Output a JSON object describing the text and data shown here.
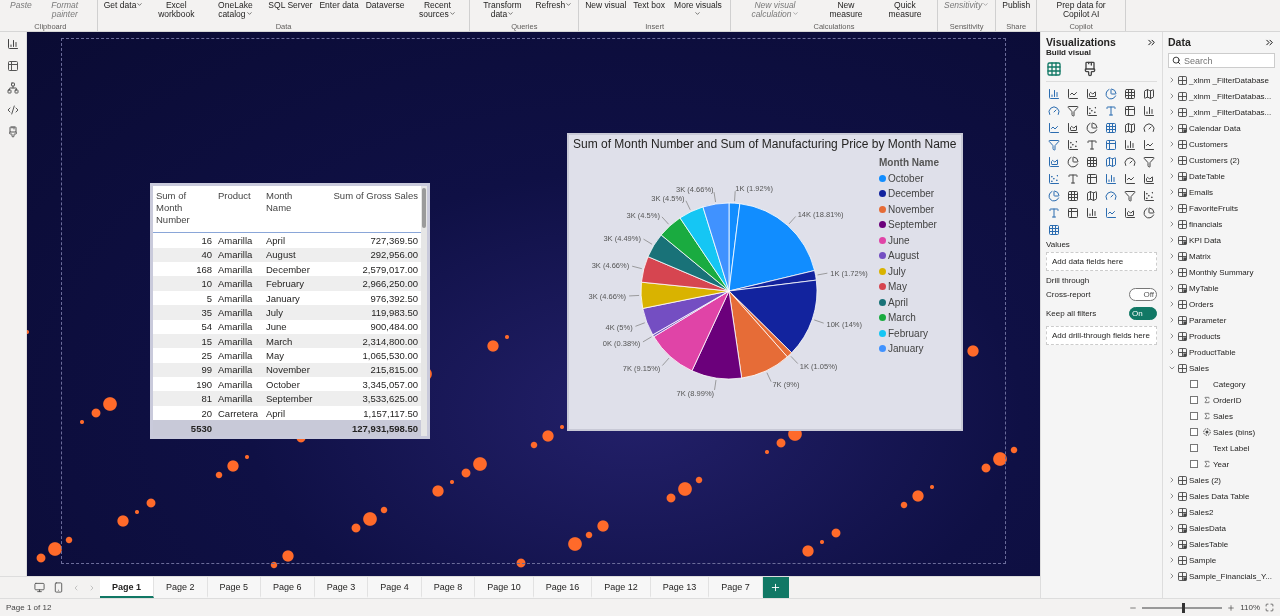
{
  "ribbon": {
    "groups": [
      {
        "label": "Clipboard",
        "buttons": [
          {
            "label": "Paste",
            "disabled": true,
            "dropdown": false
          },
          {
            "label": "Format painter",
            "disabled": true,
            "dropdown": false
          }
        ]
      },
      {
        "label": "Data",
        "buttons": [
          {
            "label": "Get data",
            "disabled": false,
            "dropdown": true
          },
          {
            "label": "Excel workbook",
            "disabled": false,
            "dropdown": false
          },
          {
            "label": "OneLake catalog",
            "disabled": false,
            "dropdown": true
          },
          {
            "label": "SQL Server",
            "disabled": false,
            "dropdown": false
          },
          {
            "label": "Enter data",
            "disabled": false,
            "dropdown": false
          },
          {
            "label": "Dataverse",
            "disabled": false,
            "dropdown": false
          },
          {
            "label": "Recent sources",
            "disabled": false,
            "dropdown": true
          }
        ]
      },
      {
        "label": "Queries",
        "buttons": [
          {
            "label": "Transform data",
            "disabled": false,
            "dropdown": true
          },
          {
            "label": "Refresh",
            "disabled": false,
            "dropdown": true
          }
        ]
      },
      {
        "label": "Insert",
        "buttons": [
          {
            "label": "New visual",
            "disabled": false,
            "dropdown": false
          },
          {
            "label": "Text box",
            "disabled": false,
            "dropdown": false
          },
          {
            "label": "More visuals",
            "disabled": false,
            "dropdown": true
          }
        ]
      },
      {
        "label": "Calculations",
        "buttons": [
          {
            "label": "New visual calculation",
            "disabled": true,
            "dropdown": true
          },
          {
            "label": "New measure",
            "disabled": false,
            "dropdown": false
          },
          {
            "label": "Quick measure",
            "disabled": false,
            "dropdown": false
          }
        ]
      },
      {
        "label": "Sensitivity",
        "buttons": [
          {
            "label": "Sensitivity",
            "disabled": true,
            "dropdown": true
          }
        ]
      },
      {
        "label": "Share",
        "buttons": [
          {
            "label": "Publish",
            "disabled": false,
            "dropdown": false
          }
        ]
      },
      {
        "label": "Copilot",
        "buttons": [
          {
            "label": "Prep data for Copilot AI",
            "disabled": false,
            "dropdown": false
          }
        ]
      }
    ]
  },
  "table_visual": {
    "columns": [
      "Sum of Month Number",
      "Product",
      "Month Name",
      "Sum of Gross Sales"
    ],
    "rows": [
      [
        "16",
        "Amarilla",
        "April",
        "727,369.50"
      ],
      [
        "40",
        "Amarilla",
        "August",
        "292,956.00"
      ],
      [
        "168",
        "Amarilla",
        "December",
        "2,579,017.00"
      ],
      [
        "10",
        "Amarilla",
        "February",
        "2,966,250.00"
      ],
      [
        "5",
        "Amarilla",
        "January",
        "976,392.50"
      ],
      [
        "35",
        "Amarilla",
        "July",
        "119,983.50"
      ],
      [
        "54",
        "Amarilla",
        "June",
        "900,484.00"
      ],
      [
        "15",
        "Amarilla",
        "March",
        "2,314,800.00"
      ],
      [
        "25",
        "Amarilla",
        "May",
        "1,065,530.00"
      ],
      [
        "99",
        "Amarilla",
        "November",
        "215,815.00"
      ],
      [
        "190",
        "Amarilla",
        "October",
        "3,345,057.00"
      ],
      [
        "81",
        "Amarilla",
        "September",
        "3,533,625.00"
      ],
      [
        "20",
        "Carretera",
        "April",
        "1,157,117.50"
      ]
    ],
    "total": {
      "month_number": "5530",
      "gross_sales": "127,931,598.50"
    }
  },
  "pie_visual": {
    "legend_title": "Month Name",
    "legend": [
      {
        "label": "October",
        "color": "#118dff"
      },
      {
        "label": "December",
        "color": "#12239e"
      },
      {
        "label": "November",
        "color": "#e66c37"
      },
      {
        "label": "September",
        "color": "#6b007b"
      },
      {
        "label": "June",
        "color": "#e044a7"
      },
      {
        "label": "August",
        "color": "#744ec2"
      },
      {
        "label": "July",
        "color": "#d9b300"
      },
      {
        "label": "May",
        "color": "#d64550"
      },
      {
        "label": "April",
        "color": "#197278"
      },
      {
        "label": "March",
        "color": "#1aab40"
      },
      {
        "label": "February",
        "color": "#15c6f4"
      },
      {
        "label": "January",
        "color": "#4092ff"
      }
    ],
    "chart_data": {
      "type": "pie",
      "title": "Sum of Month Number and Sum of Manufacturing Price by Month Name",
      "values": [
        1.92,
        18.81,
        1.72,
        14,
        1.05,
        9,
        8.99,
        9.15,
        0.38,
        5,
        4.66,
        4.66,
        4.49,
        4.5,
        4.5,
        4.66
      ],
      "colors": [
        "#118dff",
        "#118dff",
        "#12239e",
        "#12239e",
        "#e66c37",
        "#e66c37",
        "#6b007b",
        "#e044a7",
        "#744ec2",
        "#744ec2",
        "#d9b300",
        "#d64550",
        "#197278",
        "#1aab40",
        "#15c6f4",
        "#4092ff"
      ],
      "value_labels": [
        "1K (1.92%)",
        "14K (18.81%)",
        "1K (1.72%)",
        "10K (14%)",
        "1K (1.05%)",
        "7K (9%)",
        "7K (8.99%)",
        "7K (9.15%)",
        "0K (0.38%)",
        "4K (5%)",
        "3K (4.66%)",
        "3K (4.66%)",
        "3K (4.49%)",
        "3K (4.5%)",
        "3K (4.5%)",
        "3K (4.66%)"
      ]
    }
  },
  "pages": [
    {
      "label": "Page 1",
      "selected": true
    },
    {
      "label": "Page 2",
      "selected": false
    },
    {
      "label": "Page 5",
      "selected": false
    },
    {
      "label": "Page 6",
      "selected": false
    },
    {
      "label": "Page 3",
      "selected": false
    },
    {
      "label": "Page 4",
      "selected": false
    },
    {
      "label": "Page 8",
      "selected": false
    },
    {
      "label": "Page 10",
      "selected": false
    },
    {
      "label": "Page 16",
      "selected": false
    },
    {
      "label": "Page 12",
      "selected": false
    },
    {
      "label": "Page 13",
      "selected": false
    },
    {
      "label": "Page 7",
      "selected": false
    }
  ],
  "visualizations": {
    "title": "Visualizations",
    "subtitle": "Build visual",
    "values_label": "Values",
    "values_placeholder": "Add data fields here",
    "drill_label": "Drill through",
    "toggles": [
      {
        "label": "Cross-report",
        "on": false,
        "text": "Off"
      },
      {
        "label": "Keep all filters",
        "on": true,
        "text": "On"
      }
    ],
    "drill_placeholder": "Add drill-through fields here"
  },
  "data_pane": {
    "title": "Data",
    "search_placeholder": "Search",
    "items": [
      {
        "label": "_xlnm _FilterDatabase",
        "kind": "table",
        "expanded": false
      },
      {
        "label": "_xlnm _FilterDatabas...",
        "kind": "table",
        "expanded": false
      },
      {
        "label": "_xlnm _FilterDatabas...",
        "kind": "table",
        "expanded": false
      },
      {
        "label": "Calendar Data",
        "kind": "calculated",
        "expanded": false
      },
      {
        "label": "Customers",
        "kind": "table",
        "expanded": false
      },
      {
        "label": "Customers (2)",
        "kind": "table",
        "expanded": false
      },
      {
        "label": "DateTable",
        "kind": "calculated",
        "expanded": false
      },
      {
        "label": "Emails",
        "kind": "calculated",
        "expanded": false
      },
      {
        "label": "FavoriteFruits",
        "kind": "table",
        "expanded": false
      },
      {
        "label": "financials",
        "kind": "table",
        "expanded": false
      },
      {
        "label": "KPI Data",
        "kind": "calculated",
        "expanded": false
      },
      {
        "label": "Matrix",
        "kind": "calculated",
        "expanded": false
      },
      {
        "label": "Monthly Summary",
        "kind": "table",
        "expanded": false
      },
      {
        "label": "MyTable",
        "kind": "calculated",
        "expanded": false
      },
      {
        "label": "Orders",
        "kind": "table",
        "expanded": false
      },
      {
        "label": "Parameter",
        "kind": "calculated",
        "expanded": false
      },
      {
        "label": "Products",
        "kind": "calculated",
        "expanded": false
      },
      {
        "label": "ProductTable",
        "kind": "calculated",
        "expanded": false
      },
      {
        "label": "Sales",
        "kind": "table",
        "expanded": true,
        "children": [
          {
            "label": "Category",
            "kind": "text",
            "checked": false
          },
          {
            "label": "OrderID",
            "kind": "sum",
            "checked": false
          },
          {
            "label": "Sales",
            "kind": "sum",
            "checked": false
          },
          {
            "label": "Sales (bins)",
            "kind": "bins",
            "checked": false
          },
          {
            "label": "Text Label",
            "kind": "text",
            "checked": false
          },
          {
            "label": "Year",
            "kind": "sum",
            "checked": false
          }
        ]
      },
      {
        "label": "Sales (2)",
        "kind": "table",
        "expanded": false
      },
      {
        "label": "Sales Data Table",
        "kind": "table",
        "expanded": false
      },
      {
        "label": "Sales2",
        "kind": "calculated",
        "expanded": false
      },
      {
        "label": "SalesData",
        "kind": "calculated",
        "expanded": false
      },
      {
        "label": "SalesTable",
        "kind": "calculated",
        "expanded": false
      },
      {
        "label": "Sample",
        "kind": "table",
        "expanded": false
      },
      {
        "label": "Sample_Financials_Y...",
        "kind": "calculated",
        "expanded": false
      }
    ]
  },
  "status_bar": {
    "page_info": "Page 1 of 12",
    "zoom": {
      "level": 0.5,
      "reading": "110%"
    }
  }
}
